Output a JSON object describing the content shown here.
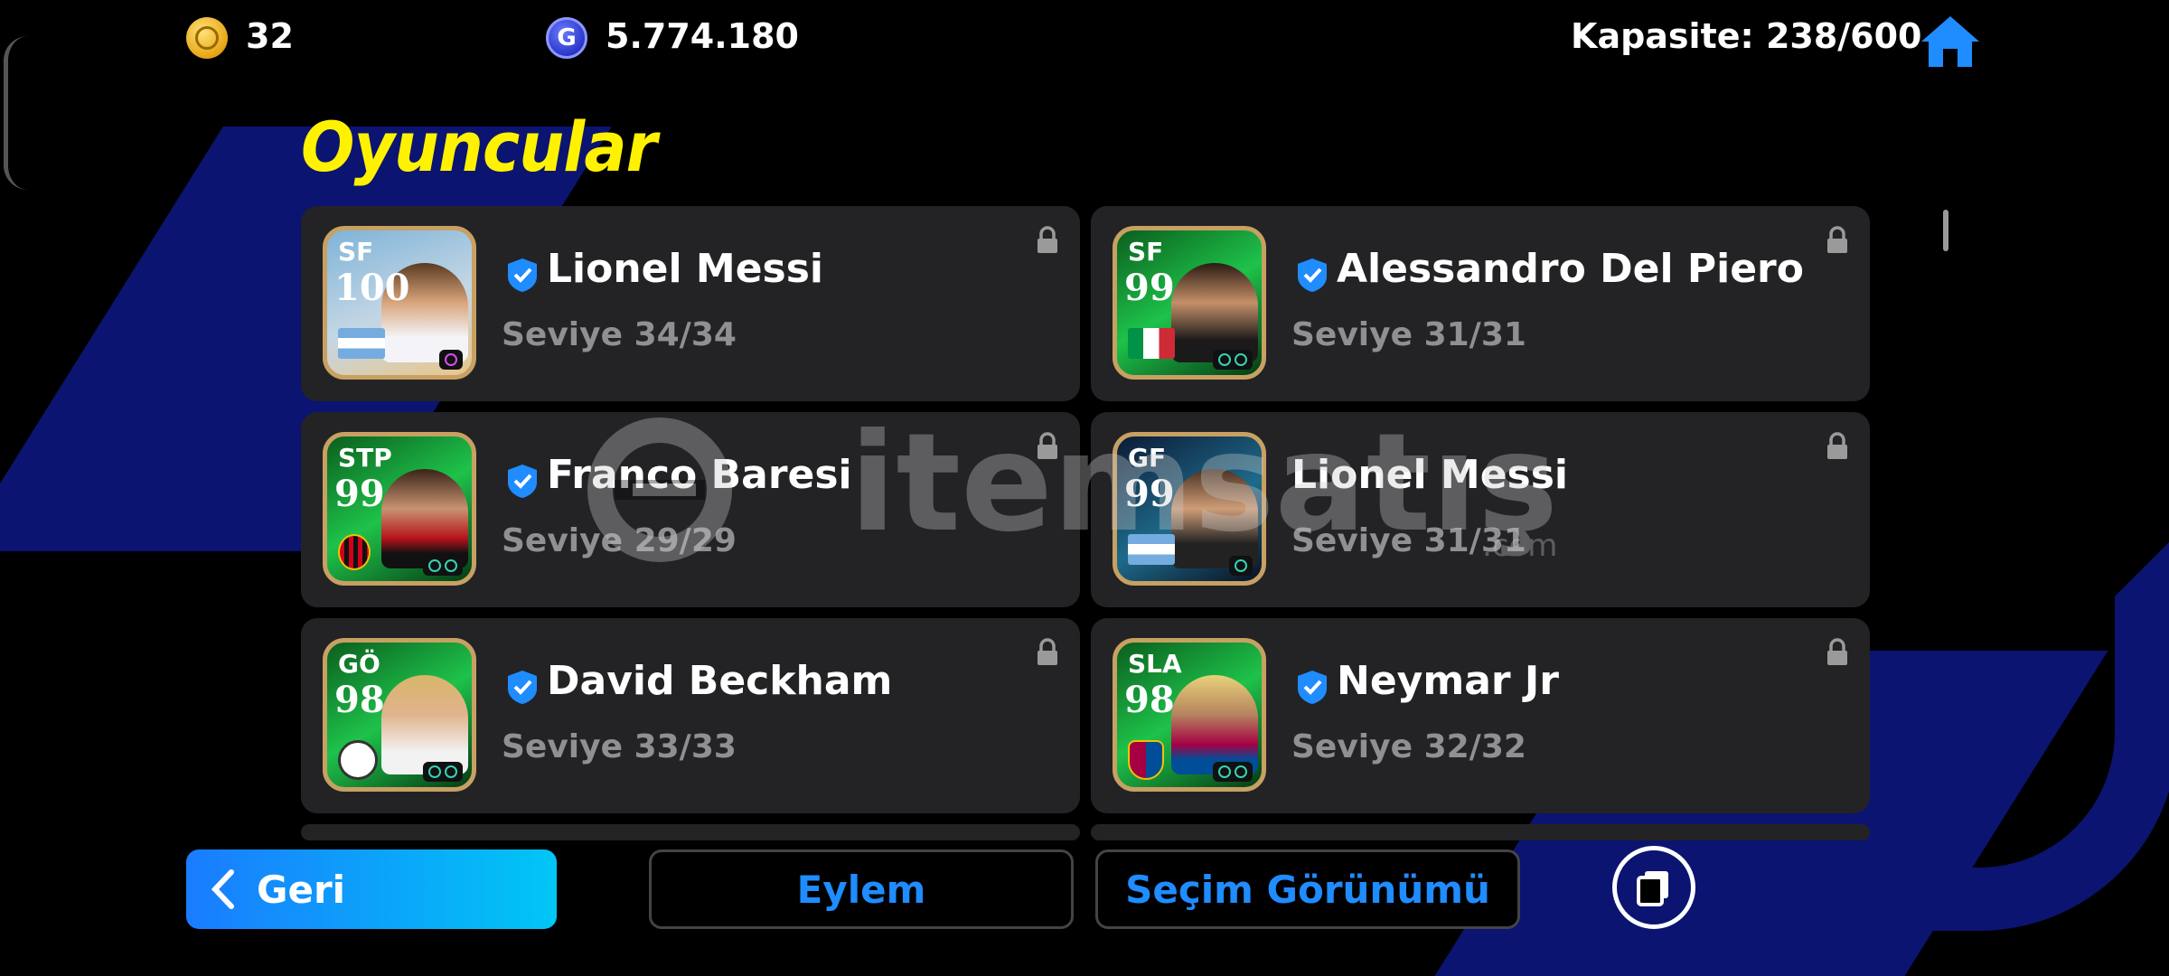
{
  "header": {
    "coins": "32",
    "gp": "5.774.180",
    "gp_icon_letter": "G",
    "capacity": "Kapasite: 238/600",
    "coin_icon": "gold-coin-icon",
    "gp_icon": "gp-coin-icon",
    "home_icon": "home-icon"
  },
  "page": {
    "title": "Oyuncular"
  },
  "players": [
    {
      "position": "SF",
      "rating": "100",
      "name": "Lionel Messi",
      "level": "Seviye 34/34",
      "verified": true,
      "locked": true
    },
    {
      "position": "SF",
      "rating": "99",
      "name": "Alessandro Del Piero",
      "level": "Seviye 31/31",
      "verified": true,
      "locked": true
    },
    {
      "position": "STP",
      "rating": "99",
      "name": "Franco Baresi",
      "level": "Seviye 29/29",
      "verified": true,
      "locked": true
    },
    {
      "position": "GF",
      "rating": "99",
      "name": "Lionel Messi",
      "level": "Seviye 31/31",
      "verified": false,
      "locked": true
    },
    {
      "position": "GÖ",
      "rating": "98",
      "name": "David Beckham",
      "level": "Seviye 33/33",
      "verified": true,
      "locked": true
    },
    {
      "position": "SLA",
      "rating": "98",
      "name": "Neymar Jr",
      "level": "Seviye 32/32",
      "verified": true,
      "locked": true
    }
  ],
  "watermark": {
    "text": "itemsatış",
    "domain": ".com"
  },
  "footer": {
    "back_label": "Geri",
    "action_label": "Eylem",
    "selection_view_label": "Seçim Görünümü",
    "copy_icon": "copy-pages-icon"
  },
  "colors": {
    "title": "#fff200",
    "accent_blue": "#1f8cff",
    "card_bg": "#232326",
    "card_frame": "#c8a062",
    "back_gradient_start": "#1a7cff",
    "back_gradient_end": "#00c6f5"
  }
}
